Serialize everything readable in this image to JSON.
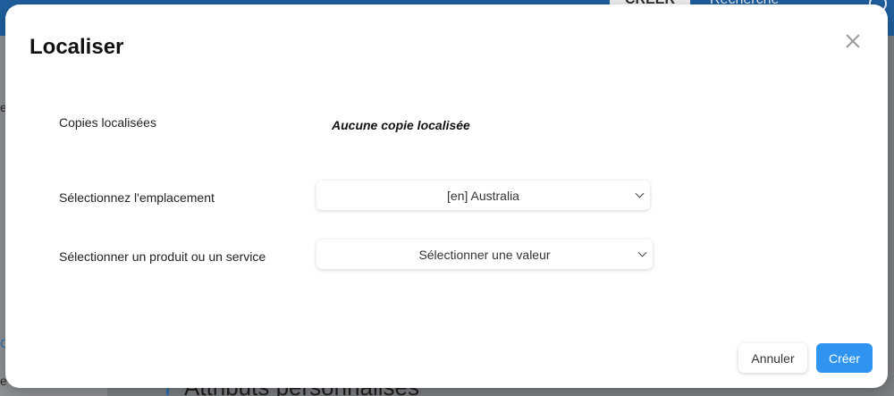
{
  "background": {
    "tabs": [
      "CRÉER",
      "Recherche"
    ],
    "section_title": "Attributs personnalisés",
    "side_letters": [
      "e",
      "C",
      "e"
    ]
  },
  "modal": {
    "title": "Localiser",
    "close_icon": "close-icon",
    "rows": {
      "copies": {
        "label": "Copies localisées",
        "value": "Aucune copie localisée"
      },
      "location": {
        "label": "Sélectionnez l'emplacement",
        "selected": "[en] Australia"
      },
      "product": {
        "label": "Sélectionner un produit ou un service",
        "selected": "Sélectionner une valeur"
      }
    },
    "buttons": {
      "cancel": "Annuler",
      "create": "Créer"
    }
  },
  "colors": {
    "primary": "#2f93f0",
    "topbar": "#1f5f9e"
  }
}
